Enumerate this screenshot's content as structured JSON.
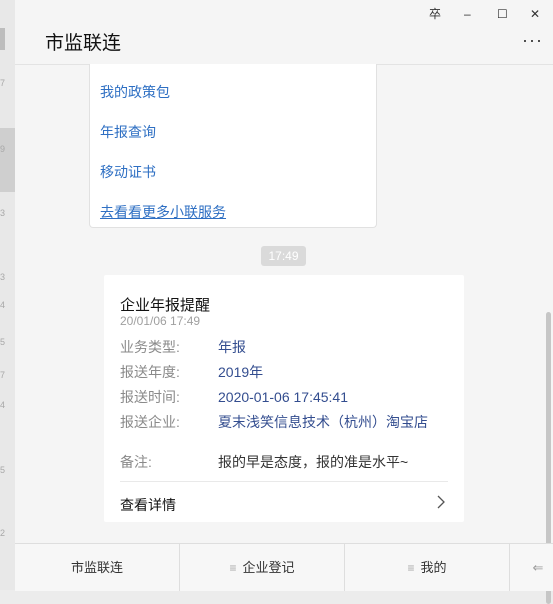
{
  "window": {
    "title": "市监联连",
    "pin_label": "卒",
    "minimize_label": "–",
    "maximize_label": "☐",
    "close_label": "✕",
    "more_label": "···"
  },
  "left_strip": {
    "numbers": [
      "7",
      "9",
      "3",
      "3",
      "4",
      "5",
      "7",
      "4",
      "5",
      "2"
    ]
  },
  "menu": {
    "items": [
      {
        "label": "我的政策包"
      },
      {
        "label": "年报查询"
      },
      {
        "label": "移动证书"
      },
      {
        "label": "去看看更多小联服务"
      }
    ]
  },
  "time_badge": "17:49",
  "notice": {
    "title": "企业年报提醒",
    "time": "20/01/06 17:49",
    "rows": [
      {
        "label": "业务类型:",
        "value": "年报"
      },
      {
        "label": "报送年度:",
        "value": "2019年"
      },
      {
        "label": "报送时间:",
        "value": "2020-01-06 17:45:41"
      },
      {
        "label": "报送企业:",
        "value": "夏末浅笑信息技术（杭州）淘宝店"
      },
      {
        "label": "备注:",
        "value": "报的早是态度，报的准是水平~"
      }
    ],
    "detail_label": "查看详情"
  },
  "bottom_nav": {
    "tabs": [
      {
        "label": "市监联连",
        "menu_icon": ""
      },
      {
        "label": "企业登记",
        "menu_icon": "≡"
      },
      {
        "label": "我的",
        "menu_icon": "≡"
      }
    ],
    "keyboard_icon": "⇐"
  }
}
